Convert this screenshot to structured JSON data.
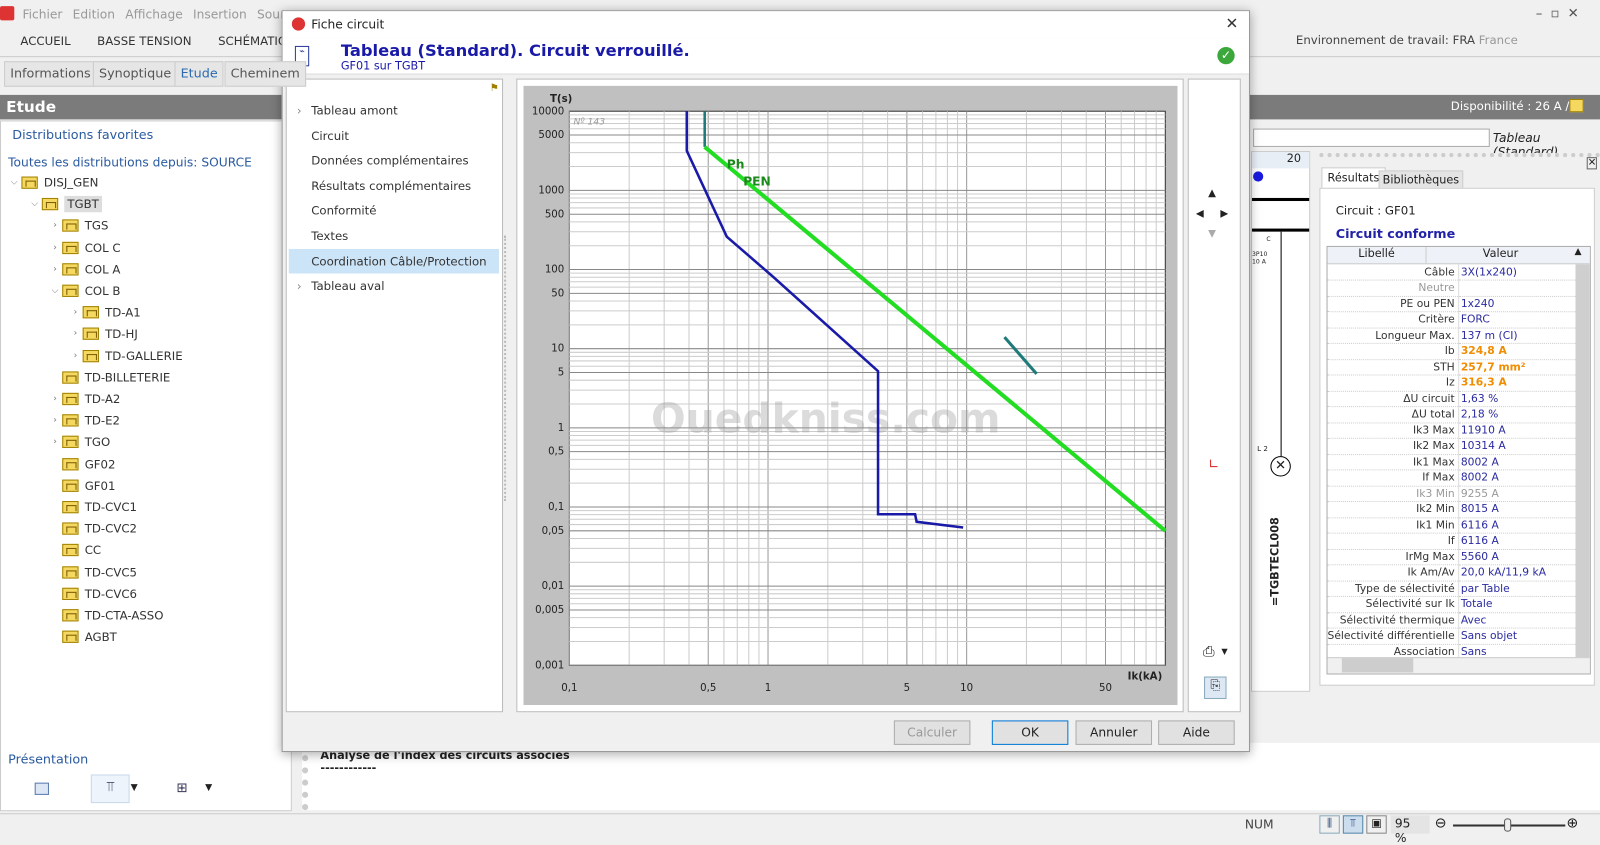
{
  "app": {
    "menu": [
      "Fichier",
      "Edition",
      "Affichage",
      "Insertion",
      "Source"
    ],
    "ribbon": [
      "ACCUEIL",
      "BASSE TENSION",
      "SCHÉMATIQUE"
    ],
    "tool_tabs": [
      "Informations",
      "Synoptique",
      "Etude",
      "Cheminem"
    ],
    "active_tool_tab": "Etude",
    "panel_title": "Etude",
    "favorites": "Distributions favorites",
    "all_distributions": "Toutes les distributions depuis: SOURCE",
    "tree": [
      {
        "label": "DISJ_GEN",
        "level": 0,
        "exp": "v"
      },
      {
        "label": "TGBT",
        "level": 1,
        "exp": "v",
        "selected": true
      },
      {
        "label": "TGS",
        "level": 2,
        "exp": ">"
      },
      {
        "label": "COL C",
        "level": 2,
        "exp": ">"
      },
      {
        "label": "COL A",
        "level": 2,
        "exp": ">"
      },
      {
        "label": "COL B",
        "level": 2,
        "exp": "v"
      },
      {
        "label": "TD-A1",
        "level": 3,
        "exp": ">"
      },
      {
        "label": "TD-HJ",
        "level": 3,
        "exp": ">"
      },
      {
        "label": "TD-GALLERIE",
        "level": 3,
        "exp": ">"
      },
      {
        "label": "TD-BILLETERIE",
        "level": 2,
        "exp": ""
      },
      {
        "label": "TD-A2",
        "level": 2,
        "exp": ">"
      },
      {
        "label": "TD-E2",
        "level": 2,
        "exp": ">"
      },
      {
        "label": "TGO",
        "level": 2,
        "exp": ">"
      },
      {
        "label": "GF02",
        "level": 2,
        "exp": ""
      },
      {
        "label": "GF01",
        "level": 2,
        "exp": ""
      },
      {
        "label": "TD-CVC1",
        "level": 2,
        "exp": ""
      },
      {
        "label": "TD-CVC2",
        "level": 2,
        "exp": ""
      },
      {
        "label": "CC",
        "level": 2,
        "exp": ""
      },
      {
        "label": "TD-CVC5",
        "level": 2,
        "exp": ""
      },
      {
        "label": "TD-CVC6",
        "level": 2,
        "exp": ""
      },
      {
        "label": "TD-CTA-ASSO",
        "level": 2,
        "exp": ""
      },
      {
        "label": "AGBT",
        "level": 2,
        "exp": ""
      }
    ],
    "presentation": "Présentation",
    "env_label": "Environnement de travail: FRA",
    "env_country": "France",
    "disponibilite": "Disponibilité : 26 A /",
    "tableau_field": "Tableau (Standard)",
    "schematic": {
      "column": "20",
      "breaker_letter": "C",
      "breaker_rating": "3P10\n10 A",
      "load": "L 2",
      "ref": "=TGBTECL008"
    },
    "analysis_title": "Analyse de l'index des circuits associés",
    "analysis_sep": "------------",
    "status": {
      "num": "NUM",
      "zoom": "95 %",
      "zoom_level": 95
    }
  },
  "results": {
    "tabs": [
      "Résultats",
      "Bibliothèques"
    ],
    "circuit": "Circuit : GF01",
    "status": "Circuit conforme",
    "headers": [
      "Libellé",
      "Valeur"
    ],
    "rows": [
      {
        "l": "Câble",
        "v": "3X(1x240)"
      },
      {
        "l": "Neutre",
        "v": "",
        "s": "g"
      },
      {
        "l": "PE ou PEN",
        "v": "1x240"
      },
      {
        "l": "Critère",
        "v": "FORC"
      },
      {
        "l": "Longueur Max.",
        "v": "137 m (CI)"
      },
      {
        "l": "Ib",
        "v": "324,8 A",
        "s": "o"
      },
      {
        "l": "STH",
        "v": "257,7 mm²",
        "s": "o"
      },
      {
        "l": "Iz",
        "v": "316,3 A",
        "s": "o"
      },
      {
        "l": "ΔU circuit",
        "v": "1,63 %"
      },
      {
        "l": "ΔU total",
        "v": "2,18 %"
      },
      {
        "l": "Ik3 Max",
        "v": "11910 A"
      },
      {
        "l": "Ik2 Max",
        "v": "10314 A"
      },
      {
        "l": "Ik1 Max",
        "v": "8002 A"
      },
      {
        "l": "If Max",
        "v": "8002 A"
      },
      {
        "l": "Ik3 Min",
        "v": "9255 A",
        "s": "g"
      },
      {
        "l": "Ik2 Min",
        "v": "8015 A"
      },
      {
        "l": "Ik1 Min",
        "v": "6116 A"
      },
      {
        "l": "If",
        "v": "6116 A"
      },
      {
        "l": "IrMg Max",
        "v": "5560 A"
      },
      {
        "l": "Ik Am/Av",
        "v": "20,0 kA/11,9 kA"
      },
      {
        "l": "Type de sélectivité",
        "v": "par Table"
      },
      {
        "l": "Sélectivité sur Ik",
        "v": "Totale"
      },
      {
        "l": "Sélectivité thermique",
        "v": "Avec"
      },
      {
        "l": "Sélectivité différentielle",
        "v": "Sans objet"
      },
      {
        "l": "Association",
        "v": "Sans"
      }
    ]
  },
  "dialog": {
    "title": "Fiche circuit",
    "heading": "Tableau (Standard).  Circuit verrouillé.",
    "subheading": "GF01 sur TGBT",
    "nav": [
      {
        "label": "Tableau amont",
        "exp": true
      },
      {
        "label": "Circuit"
      },
      {
        "label": "Données complémentaires"
      },
      {
        "label": "Résultats complémentaires"
      },
      {
        "label": "Conformité"
      },
      {
        "label": "Textes"
      },
      {
        "label": "Coordination Câble/Protection",
        "selected": true
      },
      {
        "label": "Tableau aval",
        "exp": true
      }
    ],
    "buttons": {
      "calc": "Calculer",
      "ok": "OK",
      "cancel": "Annuler",
      "help": "Aide"
    }
  },
  "chart_data": {
    "type": "line",
    "x_scale": "log",
    "y_scale": "log",
    "xlabel": "Ik(kA)",
    "ylabel": "T(s)",
    "xlim": [
      0.1,
      100
    ],
    "ylim": [
      0.001,
      10000
    ],
    "grid": true,
    "note": "Nº 143",
    "watermark": "Ouedkniss.com",
    "xticks": [
      {
        "v": 0.1,
        "t": "0,1"
      },
      {
        "v": 0.5,
        "t": "0,5"
      },
      {
        "v": 1,
        "t": "1"
      },
      {
        "v": 5,
        "t": "5"
      },
      {
        "v": 10,
        "t": "10"
      },
      {
        "v": 50,
        "t": "50"
      }
    ],
    "yticks": [
      {
        "v": 10000,
        "t": "10000"
      },
      {
        "v": 5000,
        "t": "5000"
      },
      {
        "v": 1000,
        "t": "1000"
      },
      {
        "v": 500,
        "t": "500"
      },
      {
        "v": 100,
        "t": "100"
      },
      {
        "v": 50,
        "t": "50"
      },
      {
        "v": 10,
        "t": "10"
      },
      {
        "v": 5,
        "t": "5"
      },
      {
        "v": 1,
        "t": "1"
      },
      {
        "v": 0.5,
        "t": "0,5"
      },
      {
        "v": 0.1,
        "t": "0,1"
      },
      {
        "v": 0.05,
        "t": "0,05"
      },
      {
        "v": 0.01,
        "t": "0,01"
      },
      {
        "v": 0.005,
        "t": "0,005"
      },
      {
        "v": 0.001,
        "t": "0,001"
      }
    ],
    "labels": [
      {
        "t": "Ph",
        "x": 0.62,
        "y": 1900
      },
      {
        "t": "PEN",
        "x": 0.75,
        "y": 1150
      }
    ],
    "series": [
      {
        "id": "protection",
        "color": "#1a1aa8",
        "points": [
          [
            0.39,
            10000
          ],
          [
            0.39,
            3160
          ],
          [
            0.62,
            260
          ],
          [
            1.06,
            81
          ],
          [
            3.58,
            5.2
          ],
          [
            3.58,
            0.081
          ],
          [
            5.5,
            0.081
          ],
          [
            5.6,
            0.065
          ],
          [
            9.6,
            0.055
          ]
        ]
      },
      {
        "id": "cable-pen",
        "color": "#1f7a7a",
        "points": [
          [
            0.48,
            10000
          ],
          [
            0.48,
            3540
          ]
        ]
      },
      {
        "id": "cable-ph",
        "color": "#22dd22",
        "points": [
          [
            0.48,
            3540
          ],
          [
            100,
            0.05
          ]
        ]
      },
      {
        "id": "cable-overlap",
        "color": "#1f7a7a",
        "points": [
          [
            15.5,
            14
          ],
          [
            22.5,
            4.8
          ]
        ]
      }
    ]
  }
}
